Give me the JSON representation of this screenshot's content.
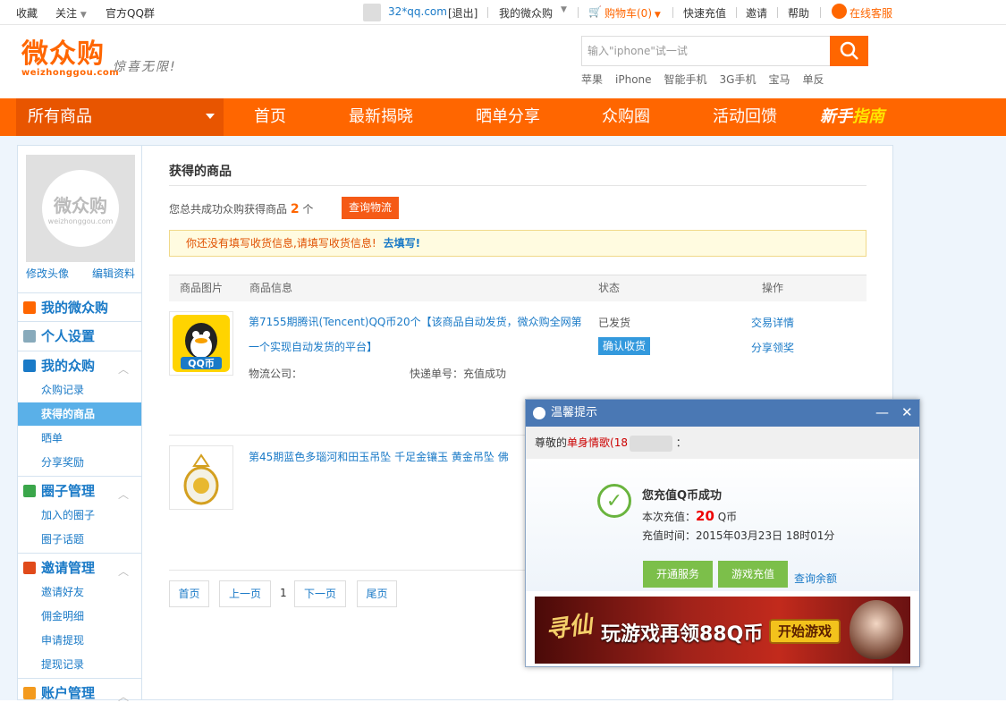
{
  "topbar": {
    "favorite": "收藏",
    "follow": "关注",
    "qq_group": "官方QQ群",
    "user": "32*qq.com",
    "logout": "[退出]",
    "my_account": "我的微众购",
    "cart": "购物车(0)",
    "recharge": "快速充值",
    "invite": "邀请",
    "help": "帮助",
    "service": "在线客服"
  },
  "header": {
    "logo": "微众购",
    "logo_sub": "weizhonggou.com",
    "slogan": "惊喜无限!",
    "search_placeholder": "输入\"iphone\"试一试",
    "hotwords": [
      "苹果",
      "iPhone",
      "智能手机",
      "3G手机",
      "宝马",
      "单反"
    ]
  },
  "nav": {
    "all": "所有商品",
    "items": [
      "首页",
      "最新揭晓",
      "晒单分享",
      "众购圈",
      "活动回馈"
    ],
    "guide_a": "新手",
    "guide_b": "指南"
  },
  "sidebar": {
    "avatar_text": "微众购",
    "avatar_sub": "weizhonggou.com",
    "edit_avatar": "修改头像",
    "edit_profile": "编辑资料",
    "my_home": "我的微众购",
    "settings": "个人设置",
    "my_purchase": "我的众购",
    "purchase_items": [
      "众购记录",
      "获得的商品",
      "晒单",
      "分享奖励"
    ],
    "circle": "圈子管理",
    "circle_items": [
      "加入的圈子",
      "圈子话题"
    ],
    "invite": "邀请管理",
    "invite_items": [
      "邀请好友",
      "佣金明细",
      "申请提现",
      "提现记录"
    ],
    "account": "账户管理"
  },
  "main": {
    "title": "获得的商品",
    "summary_pre": "您总共成功众购获得商品",
    "summary_count": "2",
    "summary_post": "个",
    "logistics_btn": "查询物流",
    "notice": "你还没有填写收货信息,请填写收货信息!",
    "notice_link": "去填写!",
    "columns": [
      "商品图片",
      "商品信息",
      "状态",
      "操作"
    ],
    "row1": {
      "title_line1": "第7155期腾讯(Tencent)QQ币20个【该商品自动发货，微众购全网第",
      "title_line2": "一个实现自动发货的平台】",
      "img_label": "QQ币",
      "logistics": "物流公司：",
      "tracking": "快递单号：充值成功",
      "status": "已发货",
      "confirm": "确认收货",
      "op1": "交易详情",
      "op2": "分享领奖"
    },
    "row2": {
      "title": "第45期蓝色多瑙河和田玉吊坠 千足金镶玉 黄金吊坠 佛"
    },
    "pager": {
      "first": "首页",
      "prev": "上一页",
      "current": "1",
      "next": "下一页",
      "last": "尾页"
    }
  },
  "popup": {
    "title": "温馨提示",
    "minimize": "—",
    "close": "✕",
    "greet_pre": "尊敬的",
    "greet_name": "单身情歌(18",
    "greet_post": "：",
    "success": "您充值Q币成功",
    "amount_pre": "本次充值：",
    "amount": "20",
    "amount_unit": "Q币",
    "time": "充值时间：2015年03月23日 18时01分",
    "btn_open": "开通服务",
    "btn_game": "游戏充值",
    "link_balance": "查询余额",
    "banner_game": "寻仙",
    "banner_text": "玩游戏再领88Q币",
    "banner_btn": "开始游戏"
  }
}
